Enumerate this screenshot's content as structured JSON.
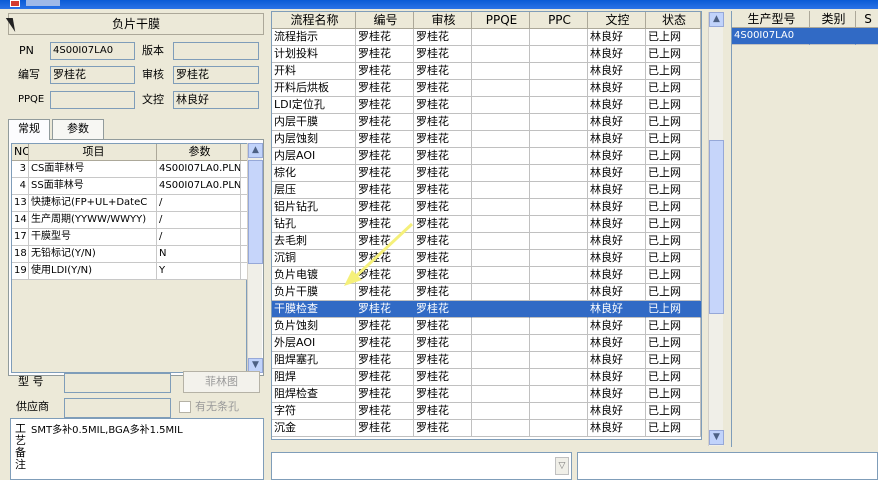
{
  "panel": {
    "title": "负片干膜",
    "pn_label": "PN",
    "pn_value": "4S00I07LA0",
    "version_label": "版本",
    "version_value": "",
    "author_label": "编写",
    "author_value": "罗桂花",
    "reviewer_label": "审核",
    "reviewer_value": "罗桂花",
    "ppqe_label": "PPQE",
    "ppqe_value": "",
    "dc_label": "文控",
    "dc_value": "林良好"
  },
  "tabs": [
    {
      "label": "常规"
    },
    {
      "label": "参数"
    }
  ],
  "params": {
    "headers": {
      "no": "NO",
      "item": "项目",
      "param": "参数"
    },
    "rows": [
      {
        "no": "3",
        "item": "CS面菲林号",
        "param": "4S00I07LA0.PLN"
      },
      {
        "no": "4",
        "item": "SS面菲林号",
        "param": "4S00I07LA0.PLN"
      },
      {
        "no": "13",
        "item": "快捷标记(FP+UL+DateC",
        "param": "/"
      },
      {
        "no": "14",
        "item": "生产周期(YYWW/WWYY)",
        "param": "/"
      },
      {
        "no": "17",
        "item": "干膜型号",
        "param": "/"
      },
      {
        "no": "18",
        "item": "无铅标记(Y/N)",
        "param": "N"
      },
      {
        "no": "19",
        "item": "使用LDI(Y/N)",
        "param": "Y"
      }
    ]
  },
  "model": {
    "label": "型  号",
    "value": "",
    "button": "菲林图"
  },
  "supplier": {
    "label": "供应商",
    "value": "",
    "checkbox_label": "有无条孔"
  },
  "remarks": {
    "label": "工艺备注",
    "text": "SMT多补0.5MIL,BGA多补1.5MIL"
  },
  "grid": {
    "headers": [
      "流程名称",
      "编号",
      "审核",
      "PPQE",
      "PPC",
      "文控",
      "状态"
    ],
    "selected_index": 16,
    "rows": [
      {
        "name": "流程指示",
        "code": "罗桂花",
        "review": "罗桂花",
        "ppqe": "",
        "ppc": "",
        "dc": "林良好",
        "status": "已上网"
      },
      {
        "name": "计划投料",
        "code": "罗桂花",
        "review": "罗桂花",
        "ppqe": "",
        "ppc": "",
        "dc": "林良好",
        "status": "已上网"
      },
      {
        "name": "开料",
        "code": "罗桂花",
        "review": "罗桂花",
        "ppqe": "",
        "ppc": "",
        "dc": "林良好",
        "status": "已上网"
      },
      {
        "name": "开料后烘板",
        "code": "罗桂花",
        "review": "罗桂花",
        "ppqe": "",
        "ppc": "",
        "dc": "林良好",
        "status": "已上网"
      },
      {
        "name": "LDI定位孔",
        "code": "罗桂花",
        "review": "罗桂花",
        "ppqe": "",
        "ppc": "",
        "dc": "林良好",
        "status": "已上网"
      },
      {
        "name": "内层干膜",
        "code": "罗桂花",
        "review": "罗桂花",
        "ppqe": "",
        "ppc": "",
        "dc": "林良好",
        "status": "已上网"
      },
      {
        "name": "内层蚀刻",
        "code": "罗桂花",
        "review": "罗桂花",
        "ppqe": "",
        "ppc": "",
        "dc": "林良好",
        "status": "已上网"
      },
      {
        "name": "内层AOI",
        "code": "罗桂花",
        "review": "罗桂花",
        "ppqe": "",
        "ppc": "",
        "dc": "林良好",
        "status": "已上网"
      },
      {
        "name": "棕化",
        "code": "罗桂花",
        "review": "罗桂花",
        "ppqe": "",
        "ppc": "",
        "dc": "林良好",
        "status": "已上网"
      },
      {
        "name": "层压",
        "code": "罗桂花",
        "review": "罗桂花",
        "ppqe": "",
        "ppc": "",
        "dc": "林良好",
        "status": "已上网"
      },
      {
        "name": "铝片钻孔",
        "code": "罗桂花",
        "review": "罗桂花",
        "ppqe": "",
        "ppc": "",
        "dc": "林良好",
        "status": "已上网"
      },
      {
        "name": "钻孔",
        "code": "罗桂花",
        "review": "罗桂花",
        "ppqe": "",
        "ppc": "",
        "dc": "林良好",
        "status": "已上网"
      },
      {
        "name": "去毛刺",
        "code": "罗桂花",
        "review": "罗桂花",
        "ppqe": "",
        "ppc": "",
        "dc": "林良好",
        "status": "已上网"
      },
      {
        "name": "沉铜",
        "code": "罗桂花",
        "review": "罗桂花",
        "ppqe": "",
        "ppc": "",
        "dc": "林良好",
        "status": "已上网"
      },
      {
        "name": "负片电镀",
        "code": "罗桂花",
        "review": "罗桂花",
        "ppqe": "",
        "ppc": "",
        "dc": "林良好",
        "status": "已上网"
      },
      {
        "name": "负片干膜",
        "code": "罗桂花",
        "review": "罗桂花",
        "ppqe": "",
        "ppc": "",
        "dc": "林良好",
        "status": "已上网"
      },
      {
        "name": "干膜检查",
        "code": "罗桂花",
        "review": "罗桂花",
        "ppqe": "",
        "ppc": "",
        "dc": "林良好",
        "status": "已上网"
      },
      {
        "name": "负片蚀刻",
        "code": "罗桂花",
        "review": "罗桂花",
        "ppqe": "",
        "ppc": "",
        "dc": "林良好",
        "status": "已上网"
      },
      {
        "name": "外层AOI",
        "code": "罗桂花",
        "review": "罗桂花",
        "ppqe": "",
        "ppc": "",
        "dc": "林良好",
        "status": "已上网"
      },
      {
        "name": "阻焊塞孔",
        "code": "罗桂花",
        "review": "罗桂花",
        "ppqe": "",
        "ppc": "",
        "dc": "林良好",
        "status": "已上网"
      },
      {
        "name": "阻焊",
        "code": "罗桂花",
        "review": "罗桂花",
        "ppqe": "",
        "ppc": "",
        "dc": "林良好",
        "status": "已上网"
      },
      {
        "name": "阻焊检查",
        "code": "罗桂花",
        "review": "罗桂花",
        "ppqe": "",
        "ppc": "",
        "dc": "林良好",
        "status": "已上网"
      },
      {
        "name": "字符",
        "code": "罗桂花",
        "review": "罗桂花",
        "ppqe": "",
        "ppc": "",
        "dc": "林良好",
        "status": "已上网"
      },
      {
        "name": "沉金",
        "code": "罗桂花",
        "review": "罗桂花",
        "ppqe": "",
        "ppc": "",
        "dc": "林良好",
        "status": "已上网"
      }
    ]
  },
  "right_grid": {
    "headers": [
      "生产型号",
      "类别",
      "S"
    ],
    "rows": [
      {
        "model": "4S00I07LA0",
        "category": "",
        "s": ""
      }
    ]
  },
  "icons": {
    "scroll_up": "▲",
    "scroll_down": "▼",
    "dropdown": "▽"
  }
}
